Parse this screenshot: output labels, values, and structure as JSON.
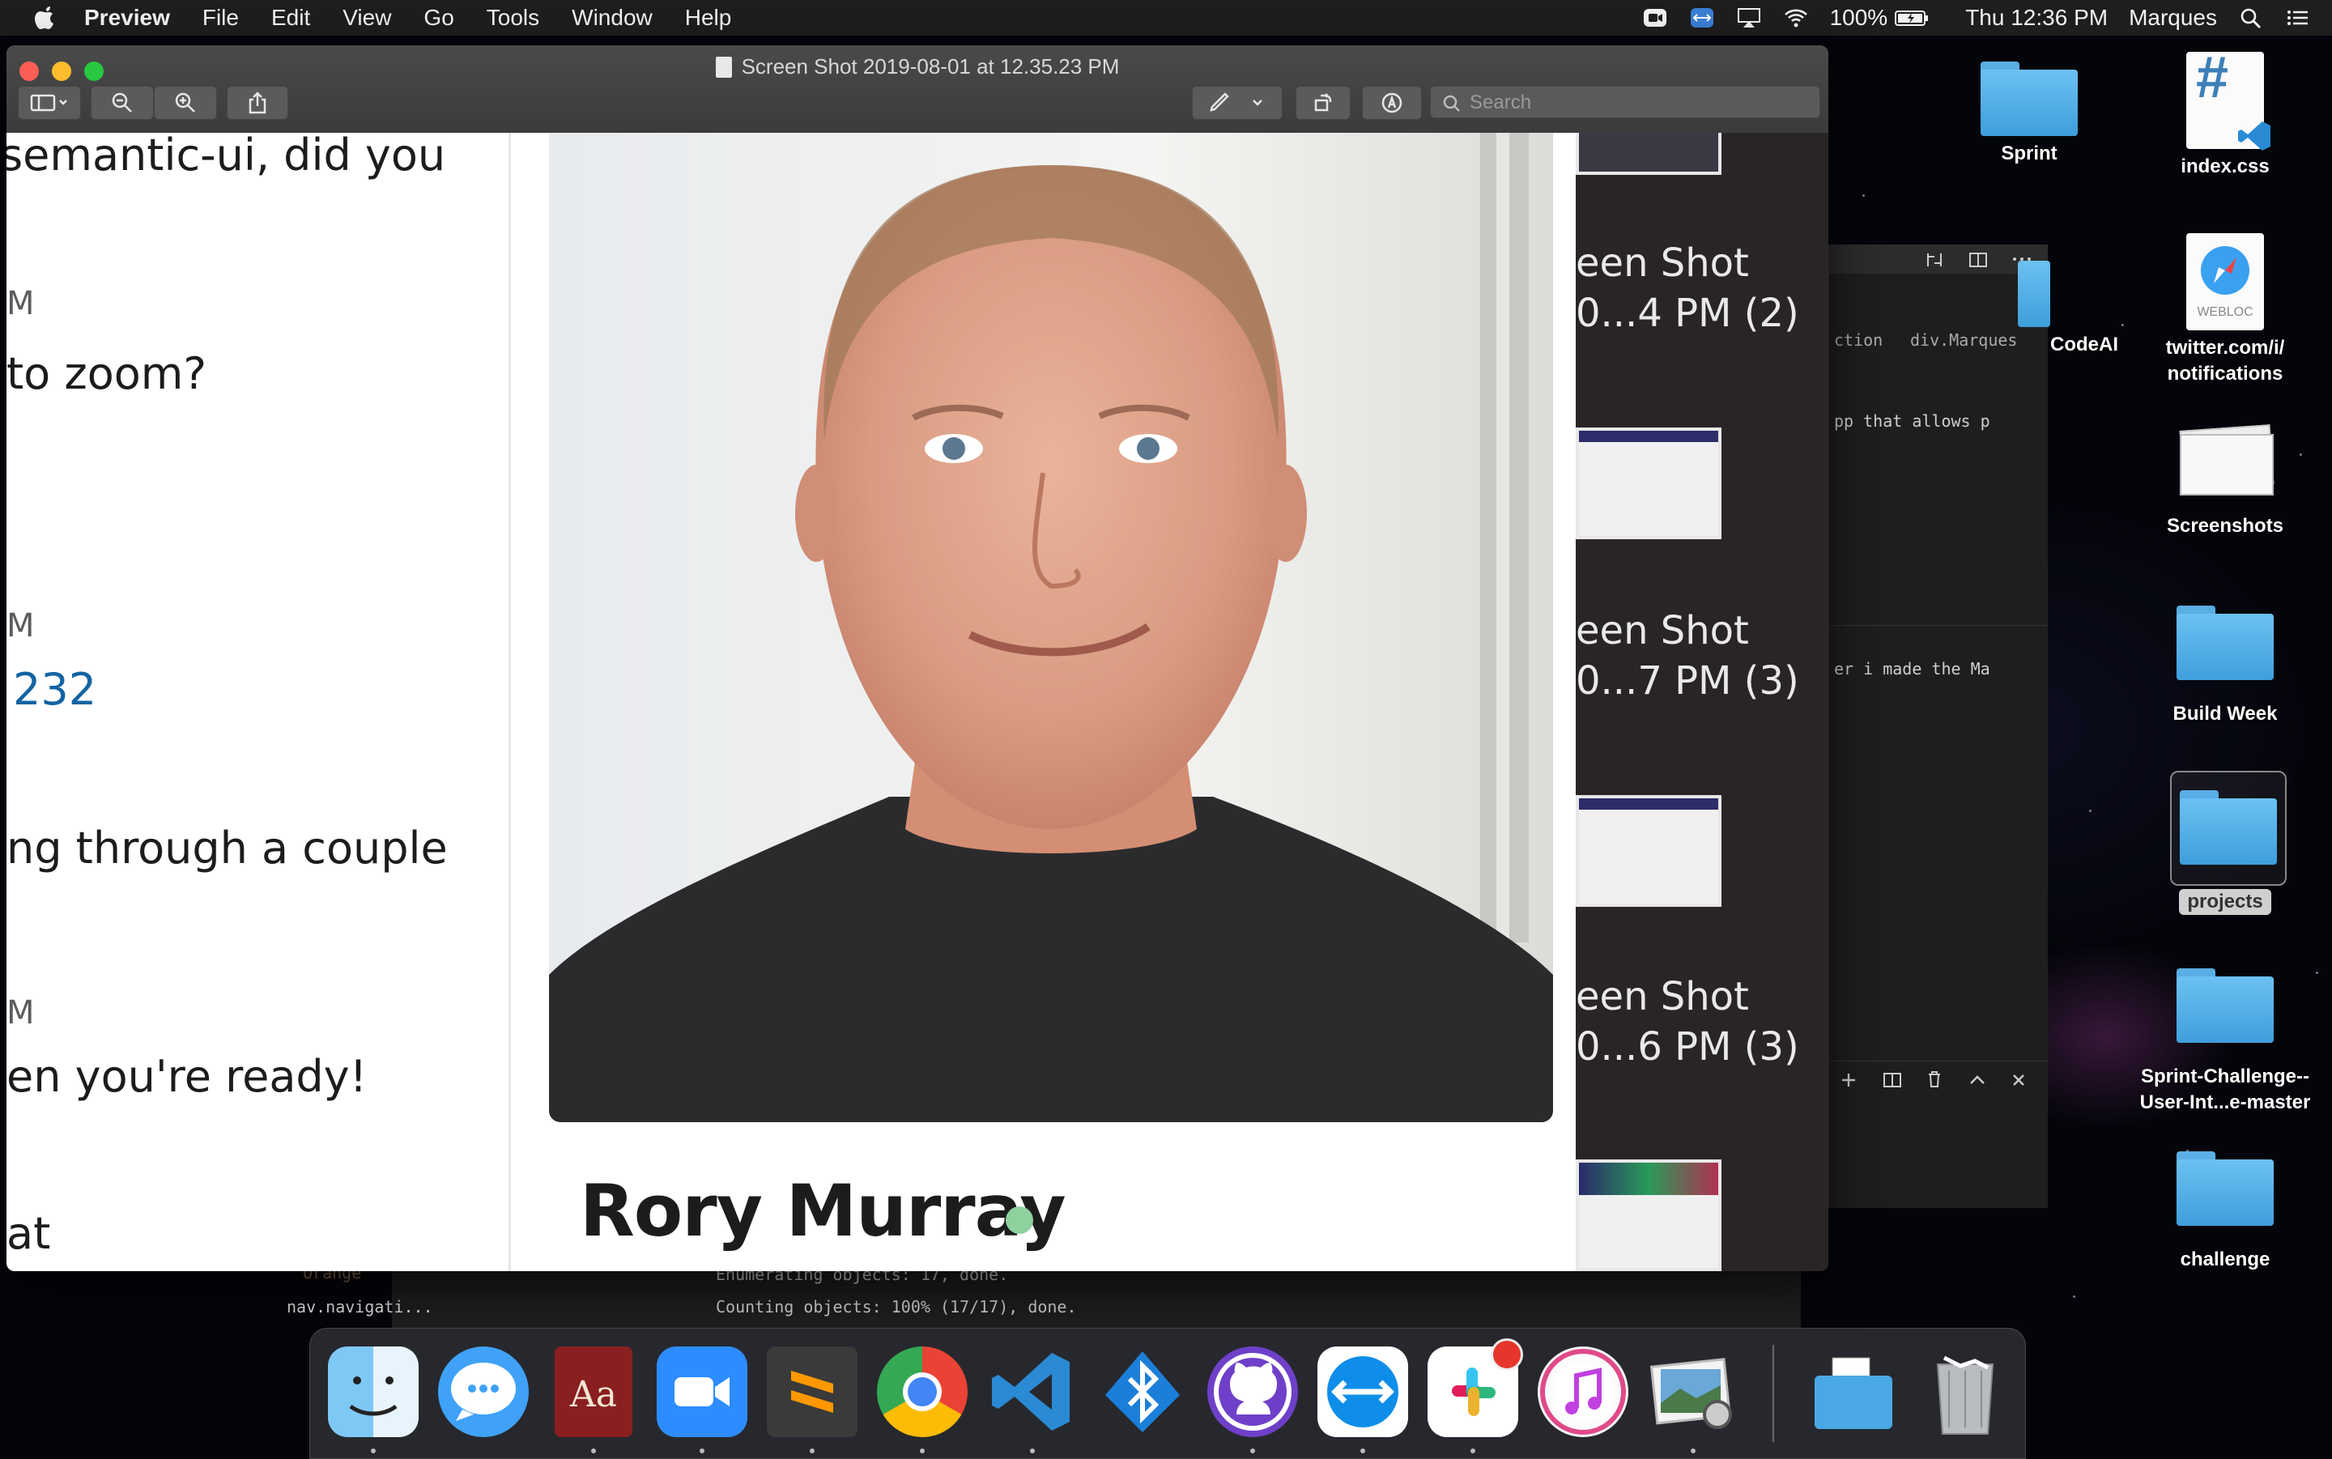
{
  "menubar": {
    "app_name": "Preview",
    "menus": [
      "File",
      "Edit",
      "View",
      "Go",
      "Tools",
      "Window",
      "Help"
    ],
    "battery": "100%",
    "clock": "Thu 12:36 PM",
    "user": "Marques"
  },
  "window": {
    "title": "Screen Shot 2019-08-01 at 12.35.23 PM",
    "search_placeholder": "Search"
  },
  "chat": {
    "lines": [
      "semantic-ui, did you",
      "M",
      " to zoom?",
      "M",
      "232",
      "ng through a couple",
      "M",
      "en you're ready!",
      "at"
    ]
  },
  "profile": {
    "name": "Rory Murray",
    "status_color": "#8fd19e"
  },
  "sidebar": {
    "thumbnails": [
      {
        "line1": "een Shot",
        "line2": "0...4 PM (2)"
      },
      {
        "line1": "een Shot",
        "line2": "0...7 PM (3)"
      },
      {
        "line1": "een Shot",
        "line2": "0...6 PM (3)"
      }
    ]
  },
  "editor": {
    "breadcrumb_a": "ction",
    "breadcrumb_b": "div.Marques",
    "code_1": "pp that allows p",
    "code_2": "er i made the Ma",
    "tree_1": "Orange",
    "tree_2": "nav.navigati...",
    "term_1": "Enumerating objects: 17, done.",
    "term_2": "Counting objects: 100% (17/17), done."
  },
  "desktop_icons": {
    "sprint": "Sprint",
    "index_css": "index.css",
    "codeai": "CodeAI",
    "twitter": "twitter.com/i/\nnotifications",
    "twitter_l1": "twitter.com/i/",
    "twitter_l2": "notifications",
    "webloc": "WEBLOC",
    "screenshots": "Screenshots",
    "build_week": "Build Week",
    "projects": "projects",
    "sprint_challenge_l1": "Sprint-Challenge--",
    "sprint_challenge_l2": "User-Int...e-master",
    "challenge": "challenge"
  },
  "dock": {
    "apps": [
      "finder-icon",
      "messages-icon",
      "dictionary-icon",
      "zoom-icon",
      "sublime-text-icon",
      "chrome-icon",
      "vscode-icon",
      "bluetooth-icon",
      "github-desktop-icon",
      "teamviewer-icon",
      "slack-icon",
      "itunes-icon",
      "preview-icon",
      "downloads-folder-icon",
      "trash-icon"
    ],
    "dictionary_label": "Aa"
  },
  "colors": {
    "accent_link": "#1264a3",
    "folder_blue": "#4aa8e6"
  }
}
